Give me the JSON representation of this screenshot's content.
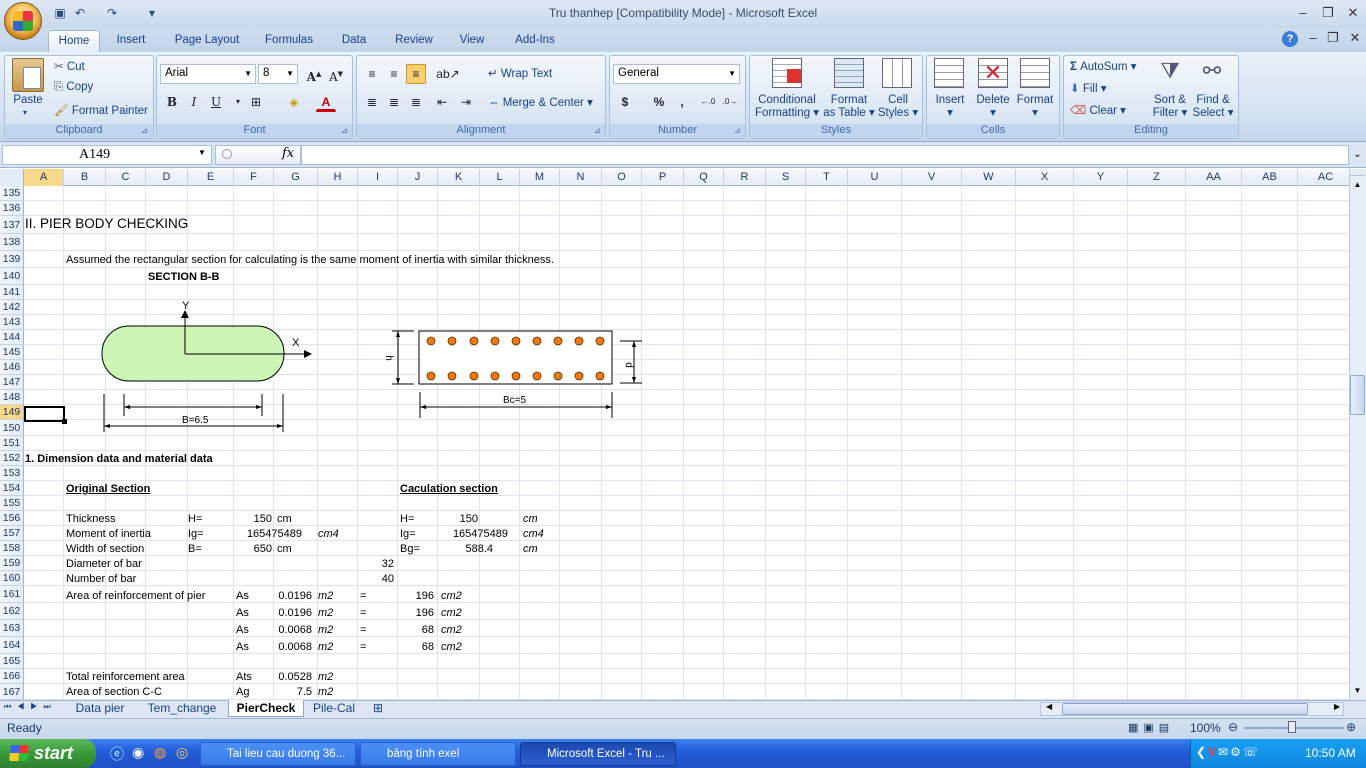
{
  "title": "Tru thanhep  [Compatibility Mode] - Microsoft Excel",
  "ribbon_tabs": [
    "Home",
    "Insert",
    "Page Layout",
    "Formulas",
    "Data",
    "Review",
    "View",
    "Add-Ins"
  ],
  "clipboard": {
    "paste": "Paste",
    "cut": "Cut",
    "copy": "Copy",
    "format_painter": "Format Painter",
    "label": "Clipboard"
  },
  "font": {
    "name": "Arial",
    "size": "8",
    "label": "Font",
    "bold": "B",
    "italic": "I",
    "underline": "U"
  },
  "alignment": {
    "wrap": "Wrap Text",
    "merge": "Merge & Center",
    "label": "Alignment"
  },
  "number": {
    "format": "General",
    "currency": "$",
    "percent": "%",
    "comma": ",",
    "label": "Number"
  },
  "styles": {
    "conditional": "Conditional",
    "conditional2": "Formatting",
    "format_table": "Format",
    "format_table2": "as Table",
    "cell_styles": "Cell",
    "cell_styles2": "Styles",
    "label": "Styles"
  },
  "cells": {
    "insert": "Insert",
    "delete": "Delete",
    "format": "Format",
    "label": "Cells"
  },
  "editing": {
    "autosum": "AutoSum",
    "fill": "Fill",
    "clear": "Clear",
    "sort": "Sort &",
    "sort2": "Filter",
    "find": "Find &",
    "find2": "Select",
    "label": "Editing"
  },
  "namebox": "A149",
  "fx": "fx",
  "columns": [
    "A",
    "B",
    "C",
    "D",
    "E",
    "F",
    "G",
    "H",
    "I",
    "J",
    "K",
    "L",
    "M",
    "N",
    "O",
    "P",
    "Q",
    "R",
    "S",
    "T",
    "U",
    "V",
    "W",
    "X",
    "Y",
    "Z",
    "AA",
    "AB",
    "AC"
  ],
  "rows": [
    "135",
    "136",
    "137",
    "138",
    "139",
    "140",
    "141",
    "142",
    "143",
    "144",
    "145",
    "146",
    "147",
    "148",
    "149",
    "150",
    "151",
    "152",
    "153",
    "154",
    "155",
    "156",
    "157",
    "158",
    "159",
    "160",
    "161",
    "162",
    "163",
    "164",
    "165",
    "166",
    "167"
  ],
  "content": {
    "heading": "II. PIER BODY CHECKING",
    "assumed": "Assumed the rectangular section for calculating is the same moment of inertia with similar thickness.",
    "section_title": "SECTION B-B",
    "axis_y": "Y",
    "axis_x": "X",
    "dim_B": "B=6.5",
    "dim_Bc": "Bc=5",
    "dim_h": "h",
    "dim_d": "d",
    "dim_title": "1. Dimension data and material data",
    "orig_section": "Original Section",
    "calc_section": "Caculation section",
    "r156": {
      "a": "Thickness",
      "b": "H=",
      "c": "150",
      "d": "cm",
      "e": "H=",
      "f": "150",
      "g": "cm"
    },
    "r157": {
      "a": "Moment of inertia",
      "b": "Ig=",
      "c": "165475489",
      "d": "cm4",
      "e": "Ig=",
      "f": "165475489",
      "g": "cm4"
    },
    "r158": {
      "a": "Width of section",
      "b": "B=",
      "c": "650",
      "d": "cm",
      "e": "Bg=",
      "f": "588.4",
      "g": "cm"
    },
    "r159": {
      "a": "Diameter of bar",
      "c": "32"
    },
    "r160": {
      "a": "Number of bar",
      "c": "40"
    },
    "r161": {
      "a": "Area of reinforcement of pier",
      "b": "As",
      "c": "0.0196",
      "d": "m2",
      "e": "=",
      "f": "196",
      "g": "cm2"
    },
    "r162": {
      "b": "As",
      "c": "0.0196",
      "d": "m2",
      "e": "=",
      "f": "196",
      "g": "cm2"
    },
    "r163": {
      "b": "As",
      "c": "0.0068",
      "d": "m2",
      "e": "=",
      "f": "68",
      "g": "cm2"
    },
    "r164": {
      "b": "As",
      "c": "0.0068",
      "d": "m2",
      "e": "=",
      "f": "68",
      "g": "cm2"
    },
    "r166": {
      "a": "Total reinforcement area",
      "b": "Ats",
      "c": "0.0528",
      "d": "m2"
    },
    "r167": {
      "a": "Area of section C-C",
      "b": "Ag",
      "c": "7.5",
      "d": "m2"
    }
  },
  "sheet_tabs": [
    "Data pier",
    "Tem_change",
    "PierCheck",
    "Pile-Cal"
  ],
  "status": {
    "ready": "Ready",
    "zoom": "100%"
  },
  "taskbar": {
    "start": "start",
    "t1": "Tai lieu cau duong 36...",
    "t2": "bảng tính exel",
    "t3": "Microsoft Excel - Tru ...",
    "clock": "10:50 AM"
  }
}
